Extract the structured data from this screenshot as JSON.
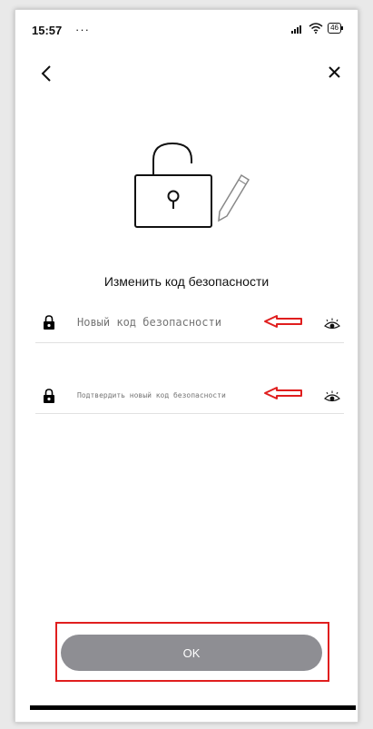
{
  "status_bar": {
    "time": "15:57",
    "dots": "···",
    "battery": "46"
  },
  "icons": {
    "back": "chevron-left-icon",
    "close": "close-icon",
    "illustration": "unlocked-padlock-with-pencil",
    "field_lock": "lock-icon",
    "field_visibility": "eye-icon",
    "annotation": "left-arrow-annotation"
  },
  "title": "Изменить код безопасности",
  "fields": {
    "new_code": {
      "placeholder": "Новый код безопасности",
      "value": ""
    },
    "confirm_code": {
      "placeholder": "Подтвердить новый код безопасности",
      "value": ""
    }
  },
  "ok_button": {
    "label": "OK"
  },
  "colors": {
    "annotation": "#e01e1e",
    "button": "#8e8e93",
    "divider": "#e1e1e1"
  }
}
